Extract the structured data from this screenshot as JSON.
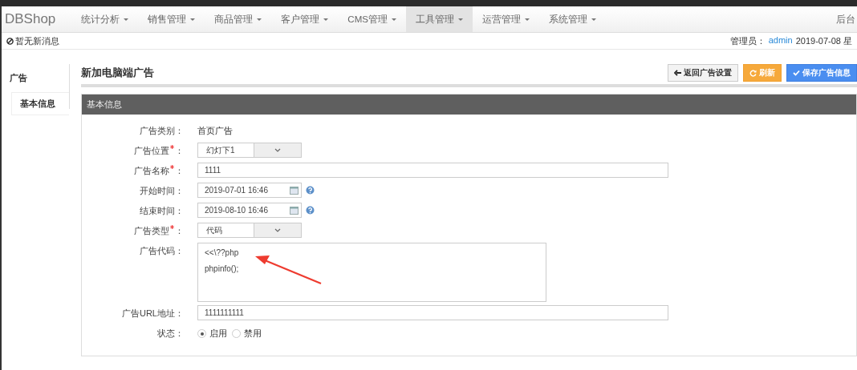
{
  "navbar": {
    "brand": "DBShop",
    "menus": [
      {
        "label": "统计分析",
        "selected": false
      },
      {
        "label": "销售管理",
        "selected": false
      },
      {
        "label": "商品管理",
        "selected": false
      },
      {
        "label": "客户管理",
        "selected": false
      },
      {
        "label": "CMS管理",
        "selected": false
      },
      {
        "label": "工具管理",
        "selected": true
      },
      {
        "label": "运营管理",
        "selected": false
      },
      {
        "label": "系统管理",
        "selected": false
      }
    ],
    "right_text": "后台"
  },
  "infobar": {
    "message": "暂无新消息",
    "admin_label": "管理员：",
    "admin_name": "admin",
    "date": "2019-07-08 星"
  },
  "sidebar": {
    "title": "广告",
    "items": [
      {
        "label": "基本信息",
        "selected": true
      }
    ]
  },
  "page": {
    "title": "新加电脑端广告",
    "buttons": [
      {
        "label": "返回广告设置",
        "kind": "back"
      },
      {
        "label": "刷新",
        "kind": "refresh"
      },
      {
        "label": "保存广告信息",
        "kind": "save"
      }
    ]
  },
  "panel": {
    "title": "基本信息",
    "fields": [
      {
        "kind": "static",
        "label": "广告类别",
        "required": false,
        "colon": "：",
        "value": "首页广告"
      },
      {
        "kind": "select",
        "label": "广告位置",
        "required": true,
        "colon": "：",
        "value": "幻灯下1"
      },
      {
        "kind": "text",
        "label": "广告名称",
        "required": true,
        "colon": "：",
        "value": "1111"
      },
      {
        "kind": "date",
        "label": "开始时间",
        "required": false,
        "colon": "：",
        "value": "2019-07-01 16:46"
      },
      {
        "kind": "date",
        "label": "结束时间",
        "required": false,
        "colon": "：",
        "value": "2019-08-10 16:46"
      },
      {
        "kind": "select",
        "label": "广告类型",
        "required": true,
        "colon": "：",
        "value": "代码"
      },
      {
        "kind": "textarea",
        "label": "广告代码",
        "required": false,
        "colon": "：",
        "lines": [
          "<<\\??php",
          "phpinfo();"
        ]
      },
      {
        "kind": "text",
        "label": "广告URL地址",
        "required": false,
        "colon": "：",
        "value": "1111111111"
      },
      {
        "kind": "radio",
        "label": "状态",
        "required": false,
        "colon": "：",
        "options": [
          {
            "label": "启用",
            "selected": true
          },
          {
            "label": "禁用",
            "selected": false
          }
        ]
      }
    ]
  }
}
